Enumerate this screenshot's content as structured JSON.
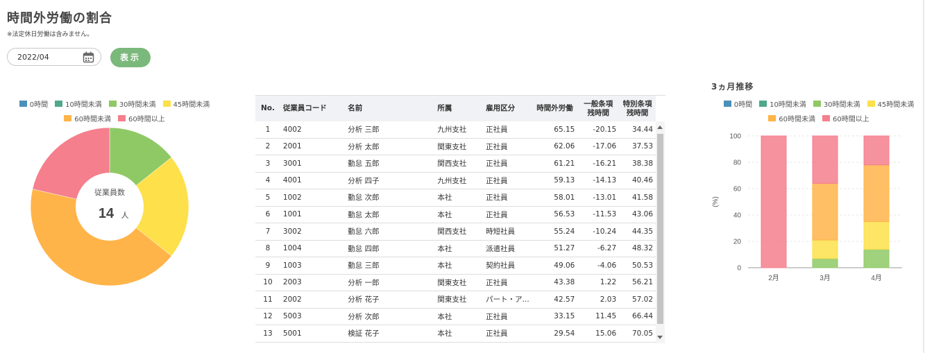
{
  "page": {
    "title": "時間外労働の割合",
    "note": "※法定休日労働は含みません。"
  },
  "filter": {
    "month_value": "2022/04",
    "show_button": "表示",
    "calendar_icon": "calendar-icon"
  },
  "legend": [
    {
      "label": "0時間",
      "color": "#4a90b8"
    },
    {
      "label": "10時間未満",
      "color": "#4fa88a"
    },
    {
      "label": "30時間未満",
      "color": "#8fc965"
    },
    {
      "label": "45時間未満",
      "color": "#fde04a"
    },
    {
      "label": "60時間未満",
      "color": "#ffb449"
    },
    {
      "label": "60時間以上",
      "color": "#f57f8c"
    }
  ],
  "donut": {
    "center_label": "従業員数",
    "center_value": "14",
    "center_unit": "人"
  },
  "table": {
    "headers": [
      "No.",
      "従業員コード",
      "名前",
      "所属",
      "雇用区分",
      "時間外労働",
      "一般条項\n残時間",
      "特別条項\n残時間"
    ],
    "rows": [
      [
        "1",
        "4002",
        "分析 三郎",
        "九州支社",
        "正社員",
        "65.15",
        "-20.15",
        "34.44"
      ],
      [
        "2",
        "2001",
        "分析 太郎",
        "関東支社",
        "正社員",
        "62.06",
        "-17.06",
        "37.53"
      ],
      [
        "3",
        "3001",
        "勤怠 五郎",
        "関西支社",
        "正社員",
        "61.21",
        "-16.21",
        "38.38"
      ],
      [
        "4",
        "4001",
        "分析 四子",
        "九州支社",
        "正社員",
        "59.13",
        "-14.13",
        "40.46"
      ],
      [
        "5",
        "1002",
        "勤怠 次郎",
        "本社",
        "正社員",
        "58.01",
        "-13.01",
        "41.58"
      ],
      [
        "6",
        "1001",
        "勤怠 太郎",
        "本社",
        "正社員",
        "56.53",
        "-11.53",
        "43.06"
      ],
      [
        "7",
        "3002",
        "勤怠 六郎",
        "関西支社",
        "時短社員",
        "55.24",
        "-10.24",
        "44.35"
      ],
      [
        "8",
        "1004",
        "勤怠 四郎",
        "本社",
        "派遣社員",
        "51.27",
        "-6.27",
        "48.32"
      ],
      [
        "9",
        "1003",
        "勤怠 三郎",
        "本社",
        "契約社員",
        "49.06",
        "-4.06",
        "50.53"
      ],
      [
        "10",
        "2003",
        "分析 一郎",
        "関東支社",
        "正社員",
        "43.38",
        "1.22",
        "56.21"
      ],
      [
        "11",
        "2002",
        "分析 花子",
        "関東支社",
        "パート・ア...",
        "42.57",
        "2.03",
        "57.02"
      ],
      [
        "12",
        "5003",
        "分析 次郎",
        "本社",
        "正社員",
        "33.15",
        "11.45",
        "66.44"
      ],
      [
        "13",
        "5001",
        "検証 花子",
        "本社",
        "正社員",
        "29.54",
        "15.06",
        "70.05"
      ]
    ]
  },
  "trend": {
    "title": "3ヵ月推移"
  },
  "chart_data": [
    {
      "type": "pie",
      "labels": [
        "0時間",
        "10時間未満",
        "30時間未満",
        "45時間未満",
        "60時間未満",
        "60時間以上"
      ],
      "values": [
        0,
        0,
        2,
        3,
        6,
        3
      ],
      "unit": "人"
    },
    {
      "type": "bar",
      "stacked": true,
      "categories": [
        "2月",
        "3月",
        "4月"
      ],
      "ylabel": "(%)",
      "ylim": [
        0,
        100
      ],
      "yticks": [
        0,
        20,
        40,
        60,
        80,
        100
      ],
      "grid": true,
      "series": [
        {
          "name": "0時間",
          "values": [
            0,
            0,
            0
          ]
        },
        {
          "name": "10時間未満",
          "values": [
            0,
            0,
            0
          ]
        },
        {
          "name": "30時間未満",
          "values": [
            0,
            7,
            14
          ]
        },
        {
          "name": "45時間未満",
          "values": [
            0,
            14,
            21
          ]
        },
        {
          "name": "60時間未満",
          "values": [
            0,
            43,
            43
          ]
        },
        {
          "name": "60時間以上",
          "values": [
            100,
            36,
            22
          ]
        }
      ]
    }
  ]
}
